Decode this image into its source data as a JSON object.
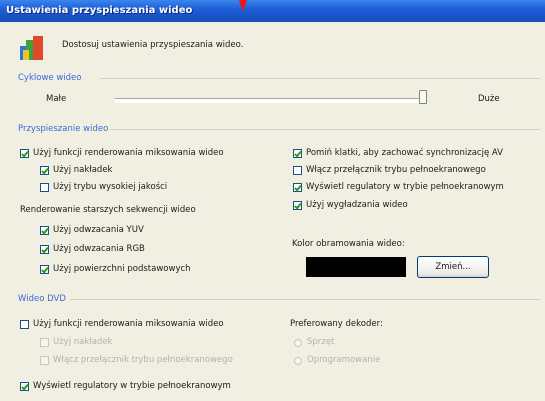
{
  "window": {
    "title": "Ustawienia przyspieszania wideo"
  },
  "intro": {
    "text": "Dostosuj ustawienia przyspieszania wideo."
  },
  "cyclic": {
    "title": "Cyklowe wideo",
    "min_label": "Małe",
    "max_label": "Duże",
    "slider_level": 1.0
  },
  "accel": {
    "title": "Przyspieszanie wideo",
    "use_mixing": "Użyj funkcji renderowania miksowania wideo",
    "use_overlays": "Użyj nakładek",
    "high_quality": "Użyj trybu wysokiej jakości",
    "legacy_title": "Renderowanie starszych sekwencji wideo",
    "yuv": "Użyj odwzacania YUV",
    "rgb": "Użyj odwzacania RGB",
    "surfaces": "Użyj powierzchni podstawowych",
    "skip_frames": "Pomiń klatki, aby zachować synchronizację AV",
    "fullscreen_toggle": "Włącz przełącznik trybu pełnoekranowego",
    "show_controls": "Wyświetl regulatory w trybie pełnoekranowym",
    "smoothing": "Użyj wygładzania wideo",
    "color_label": "Kolor obramowania wideo:",
    "change_button": "Zmień...",
    "border_color": "#000000"
  },
  "dvd": {
    "title": "Wideo DVD",
    "use_mixing": "Użyj funkcji renderowania miksowania wideo",
    "use_overlays": "Użyj nakładek",
    "fullscreen_toggle": "Włącz przełącznik trybu pełnoekranowego",
    "decoder_label": "Preferowany dekoder:",
    "decoder_hw": "Sprzęt",
    "decoder_sw": "Oprogramowanie",
    "show_controls": "Wyświetl regulatory w trybie pełnoekranowym"
  },
  "colors": {
    "title_bar": "#1e5fd8",
    "group_title": "#3a6ad6",
    "arrow": "#e8191c"
  }
}
